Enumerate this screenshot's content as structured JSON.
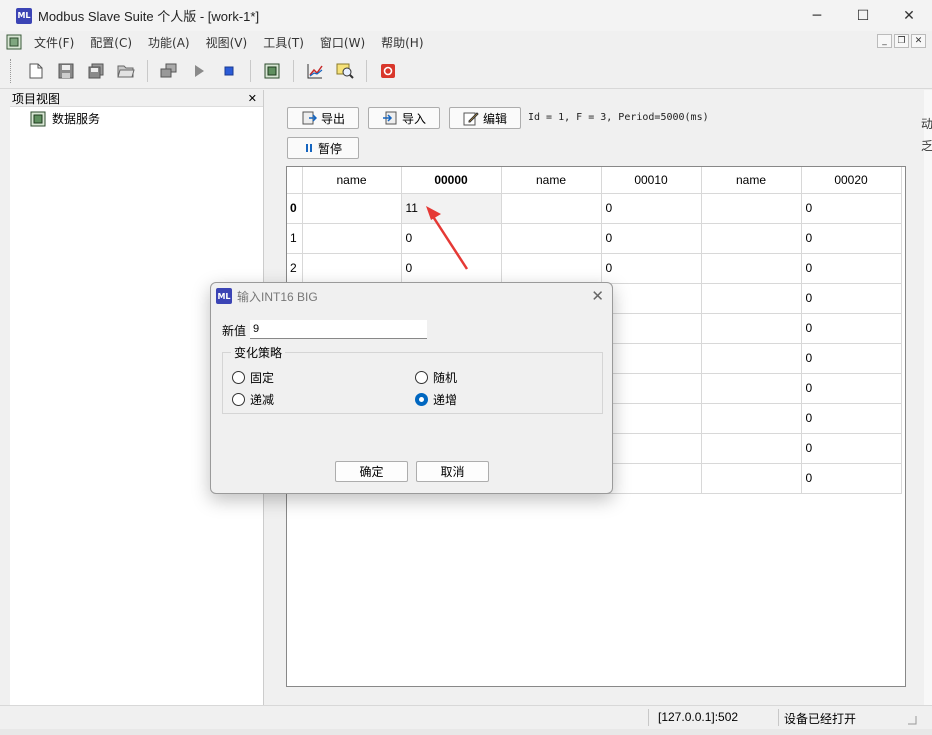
{
  "app": {
    "title": "Modbus Slave Suite 个人版  - [work-1*]",
    "logo_text": "ML",
    "window_controls": [
      "─",
      "☐",
      "✕"
    ]
  },
  "menu": {
    "items": [
      "文件(F)",
      "配置(C)",
      "功能(A)",
      "视图(V)",
      "工具(T)",
      "窗口(W)",
      "帮助(H)"
    ],
    "mdi_controls": [
      "_",
      "❐",
      "✕"
    ]
  },
  "toolbar": {
    "icons": [
      "new-file-icon",
      "save-icon",
      "save-all-icon",
      "open-folder-icon",
      "connect-icon",
      "play-icon",
      "stop-icon",
      "device-icon",
      "chart-icon",
      "search-icon",
      "record-icon"
    ]
  },
  "project_view": {
    "title": "项目视图",
    "close": "✕",
    "items": [
      {
        "label": "数据服务"
      }
    ]
  },
  "main": {
    "export_label": "导出",
    "import_label": "导入",
    "edit_label": "编辑",
    "pause_label": "暂停",
    "info": "Id = 1, F = 3, Period=5000(ms)"
  },
  "grid": {
    "headers": [
      "name",
      "00000",
      "name",
      "00010",
      "name",
      "00020"
    ],
    "rows": [
      {
        "num": "0",
        "cells": [
          "",
          "11",
          "",
          "0",
          "",
          "0"
        ]
      },
      {
        "num": "1",
        "cells": [
          "",
          "0",
          "",
          "0",
          "",
          "0"
        ]
      },
      {
        "num": "2",
        "cells": [
          "",
          "0",
          "",
          "0",
          "",
          "0"
        ]
      },
      {
        "num": "",
        "cells": [
          "",
          "",
          "",
          "",
          "",
          "0"
        ]
      },
      {
        "num": "",
        "cells": [
          "",
          "",
          "",
          "",
          "",
          "0"
        ]
      },
      {
        "num": "",
        "cells": [
          "",
          "",
          "",
          "",
          "",
          "0"
        ]
      },
      {
        "num": "",
        "cells": [
          "",
          "",
          "",
          "",
          "",
          "0"
        ]
      },
      {
        "num": "",
        "cells": [
          "",
          "",
          "",
          "",
          "",
          "0"
        ]
      },
      {
        "num": "",
        "cells": [
          "",
          "",
          "",
          "",
          "",
          "0"
        ]
      },
      {
        "num": "",
        "cells": [
          "",
          "",
          "",
          "",
          "",
          "0"
        ]
      }
    ]
  },
  "dialog": {
    "title": "输入INT16 BIG",
    "close": "✕",
    "new_value_label": "新值",
    "new_value": "9",
    "group_title": "变化策略",
    "options": [
      {
        "label": "固定",
        "checked": false
      },
      {
        "label": "随机",
        "checked": false
      },
      {
        "label": "递减",
        "checked": false
      },
      {
        "label": "递增",
        "checked": true
      }
    ],
    "ok_label": "确定",
    "cancel_label": "取消"
  },
  "status": {
    "address": "[127.0.0.1]:502",
    "state": "设备已经打开"
  },
  "right_edge": {
    "chars": [
      "动",
      "乏"
    ]
  },
  "colors": {
    "accent": "#0067c0",
    "arrow": "#e53935",
    "logo": "#3b44b5"
  }
}
